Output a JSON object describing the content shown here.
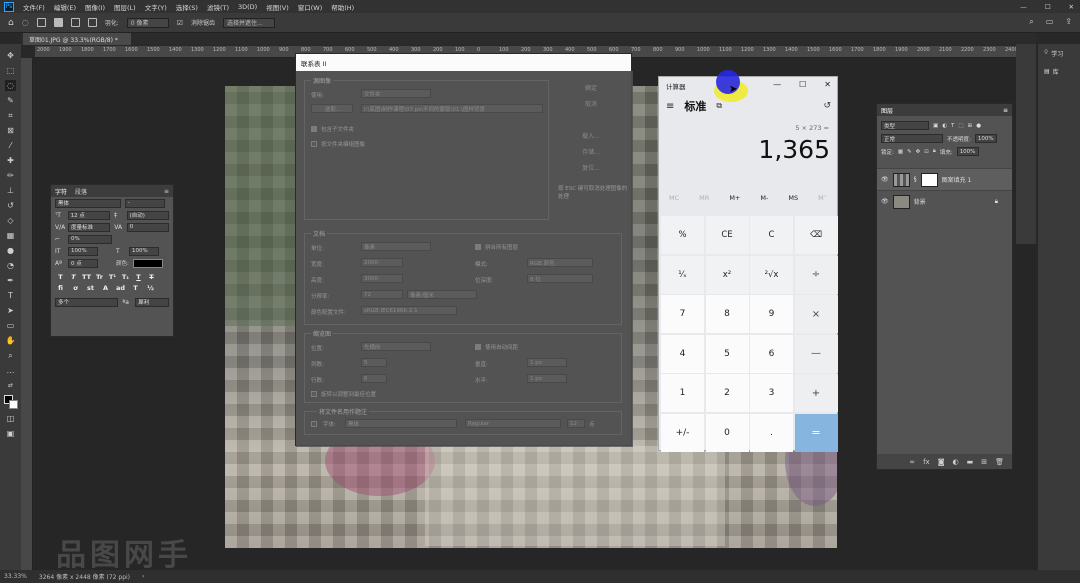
{
  "menubar": {
    "items": [
      "文件(F)",
      "编辑(E)",
      "图像(I)",
      "图层(L)",
      "文字(Y)",
      "选择(S)",
      "滤镜(T)",
      "3D(D)",
      "视图(V)",
      "窗口(W)",
      "帮助(H)"
    ]
  },
  "optionsbar": {
    "feather_label": "羽化:",
    "feather_value": "0 像素",
    "antialias_label": "消除锯齿",
    "select_subject": "选择并遮住..."
  },
  "document_tab": {
    "label": "草图01.JPG @ 33.3%(RGB/8) *"
  },
  "ruler_numbers": [
    "2000",
    "1900",
    "1800",
    "1700",
    "1600",
    "1500",
    "1400",
    "1300",
    "1200",
    "1100",
    "1000",
    "900",
    "800",
    "700",
    "600",
    "500",
    "400",
    "300",
    "200",
    "100",
    "0",
    "100",
    "200",
    "300",
    "400",
    "500",
    "600",
    "700",
    "800",
    "900",
    "1000",
    "1100",
    "1200",
    "1300",
    "1400",
    "1500",
    "1600",
    "1700",
    "1800",
    "1900",
    "2000",
    "2100",
    "2200",
    "2300",
    "2400",
    "2500"
  ],
  "statusbar": {
    "zoom": "33.33%",
    "doc_size": "3264 像素 x 2448 像素 (72 ppi)"
  },
  "watermark": "品图网手",
  "char_panel": {
    "tab_character": "字符",
    "tab_paragraph": "段落",
    "font_family": "黑体",
    "font_style": "-",
    "font_size": "12 点",
    "leading": "(自动)",
    "kerning": "度量标准",
    "tracking": "0",
    "tsume": "0%",
    "vscale": "100%",
    "hscale": "100%",
    "baseline": "0 点",
    "color_label": "颜色:",
    "language": "多个",
    "antialias": "犀利",
    "styles": [
      "T",
      "T",
      "TT",
      "Tr",
      "T¹",
      "T₁",
      "T",
      "T"
    ]
  },
  "dialog": {
    "title": "联系表 II",
    "source_group": "源图像",
    "use_label": "使用:",
    "use_value": "文件夹",
    "choose_btn": "选取...",
    "path": "I:\\底图\\制作课程\\07.ps\\不同的蒙版\\01.\\图样背景",
    "include_sub": "包含子文件夹",
    "group_by_folder": "按文件夹编组图像",
    "doc_group": "文档",
    "units_label": "单位:",
    "units_value": "像素",
    "width_label": "宽度:",
    "width_value": "2000",
    "height_label": "高度:",
    "height_value": "3000",
    "resolution_label": "分辨率:",
    "resolution_value": "72",
    "resolution_unit": "像素/厘米",
    "color_profile_label": "颜色配置文件:",
    "color_profile_value": "sRGB IEC61966-2.1",
    "flatten_label": "拼合所有图层",
    "mode_label": "模式:",
    "mode_value": "RGB 颜色",
    "bitdepth_label": "位深度:",
    "bitdepth_value": "8 位",
    "thumb_group": "缩览图",
    "place_label": "位置:",
    "place_value": "先横向",
    "autospace_label": "使用自动间距",
    "cols_label": "列数:",
    "cols_value": "5",
    "rows_label": "行数:",
    "rows_value": "6",
    "vert_label": "垂直:",
    "vert_value": "1 px",
    "horz_label": "水平:",
    "horz_value": "1 px",
    "rotate_label": "旋转以调整到最佳位置",
    "caption_group": "将文件名用作题注",
    "font_label": "字体:",
    "font_value": "黑体",
    "font_style_value": "Regular",
    "font_size_value": "12",
    "font_size_unit": "点",
    "ok": "确定",
    "cancel": "取消",
    "load": "载入...",
    "save": "存储...",
    "reset": "复位...",
    "esc_note": "按 ESC 键可取消处理图像的处理"
  },
  "calculator": {
    "title": "计算器",
    "mode": "标准",
    "expression": "5 × 273 =",
    "result": "1,365",
    "memory": [
      {
        "label": "MC",
        "enabled": false
      },
      {
        "label": "MR",
        "enabled": false
      },
      {
        "label": "M+",
        "enabled": true
      },
      {
        "label": "M-",
        "enabled": true
      },
      {
        "label": "MS",
        "enabled": true
      },
      {
        "label": "M˅",
        "enabled": false
      }
    ],
    "keys": [
      {
        "label": "%",
        "kind": "fn"
      },
      {
        "label": "CE",
        "kind": "fn"
      },
      {
        "label": "C",
        "kind": "fn"
      },
      {
        "label": "⌫",
        "kind": "fn"
      },
      {
        "label": "¹⁄ₓ",
        "kind": "fn"
      },
      {
        "label": "x²",
        "kind": "fn"
      },
      {
        "label": "²√x",
        "kind": "fn"
      },
      {
        "label": "÷",
        "kind": "op"
      },
      {
        "label": "7",
        "kind": "num"
      },
      {
        "label": "8",
        "kind": "num"
      },
      {
        "label": "9",
        "kind": "num"
      },
      {
        "label": "×",
        "kind": "op"
      },
      {
        "label": "4",
        "kind": "num"
      },
      {
        "label": "5",
        "kind": "num"
      },
      {
        "label": "6",
        "kind": "num"
      },
      {
        "label": "—",
        "kind": "op"
      },
      {
        "label": "1",
        "kind": "num"
      },
      {
        "label": "2",
        "kind": "num"
      },
      {
        "label": "3",
        "kind": "num"
      },
      {
        "label": "+",
        "kind": "op"
      },
      {
        "label": "+/-",
        "kind": "num"
      },
      {
        "label": "0",
        "kind": "num"
      },
      {
        "label": ".",
        "kind": "num"
      },
      {
        "label": "=",
        "kind": "eq"
      }
    ]
  },
  "layers_panel": {
    "tab": "图层",
    "filter_label": "类型",
    "blend_mode": "正常",
    "opacity_label": "不透明度:",
    "opacity_value": "100%",
    "lock_label": "锁定:",
    "fill_label": "填充:",
    "fill_value": "100%",
    "layers": [
      {
        "name": "图案填充 1",
        "has_mask": true
      },
      {
        "name": "背景",
        "locked": true
      }
    ]
  },
  "dock": {
    "learn": "学习",
    "library": "库"
  },
  "colors": {
    "calc_equals": "#86b6df",
    "ps_bg": "#282828",
    "panel_bg": "#535353"
  }
}
